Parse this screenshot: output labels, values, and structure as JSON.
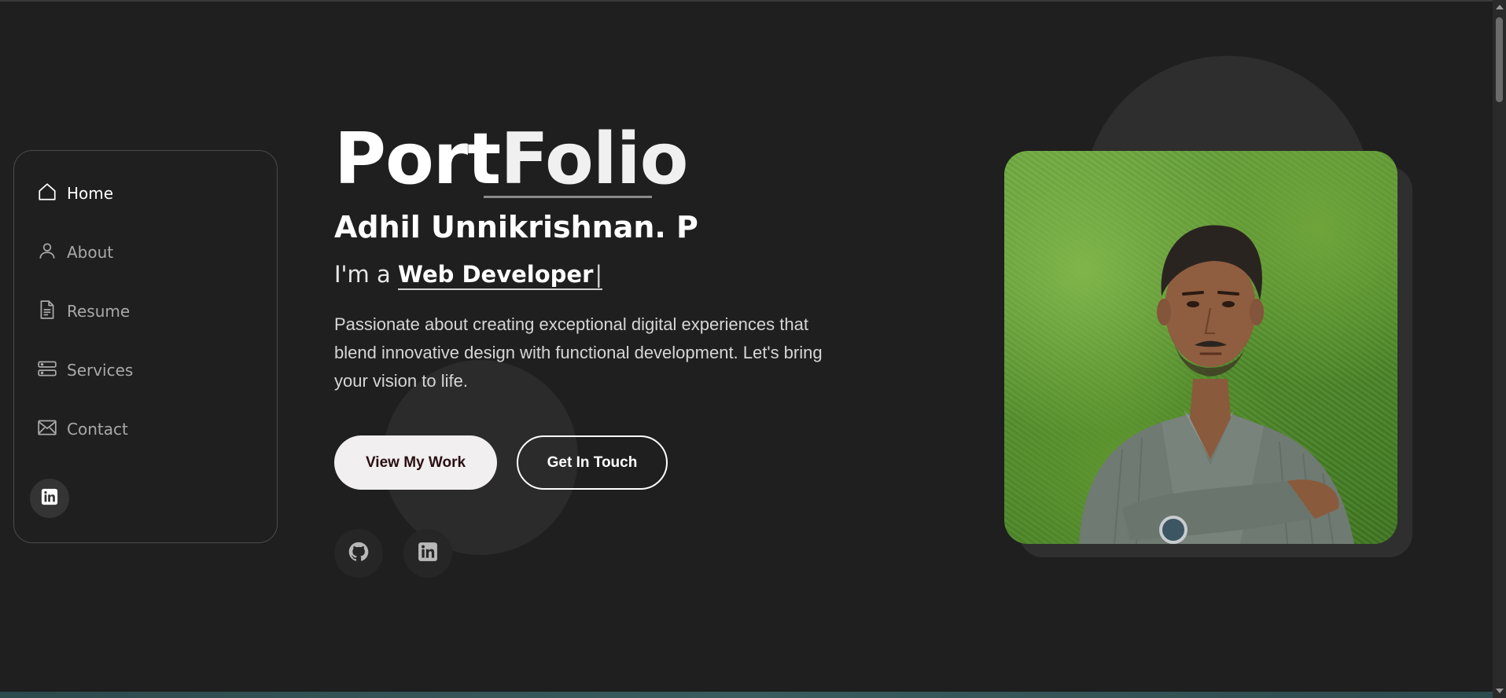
{
  "sidebar": {
    "items": [
      {
        "label": "Home",
        "icon": "home-icon",
        "active": true
      },
      {
        "label": "About",
        "icon": "user-icon",
        "active": false
      },
      {
        "label": "Resume",
        "icon": "document-icon",
        "active": false
      },
      {
        "label": "Services",
        "icon": "server-icon",
        "active": false
      },
      {
        "label": "Contact",
        "icon": "envelope-icon",
        "active": false
      }
    ],
    "social_icon": "linkedin-icon"
  },
  "hero": {
    "title_part1": "Port",
    "title_part2": "Folio",
    "name": "Adhil Unnikrishnan. P",
    "role_prefix": "I'm a ",
    "role": "Web Developer",
    "cursor": "|",
    "description": "Passionate about creating exceptional digital experiences that blend innovative design with functional development. Let's bring your vision to life.",
    "primary_button": "View My Work",
    "secondary_button": "Get In Touch",
    "social_icons": [
      "github-icon",
      "linkedin-icon"
    ]
  },
  "colors": {
    "background": "#1f1f1f",
    "text": "#ffffff",
    "muted_text": "#a9a9a9",
    "button_primary_bg": "#f1efef",
    "button_primary_text": "#2a0f12"
  }
}
